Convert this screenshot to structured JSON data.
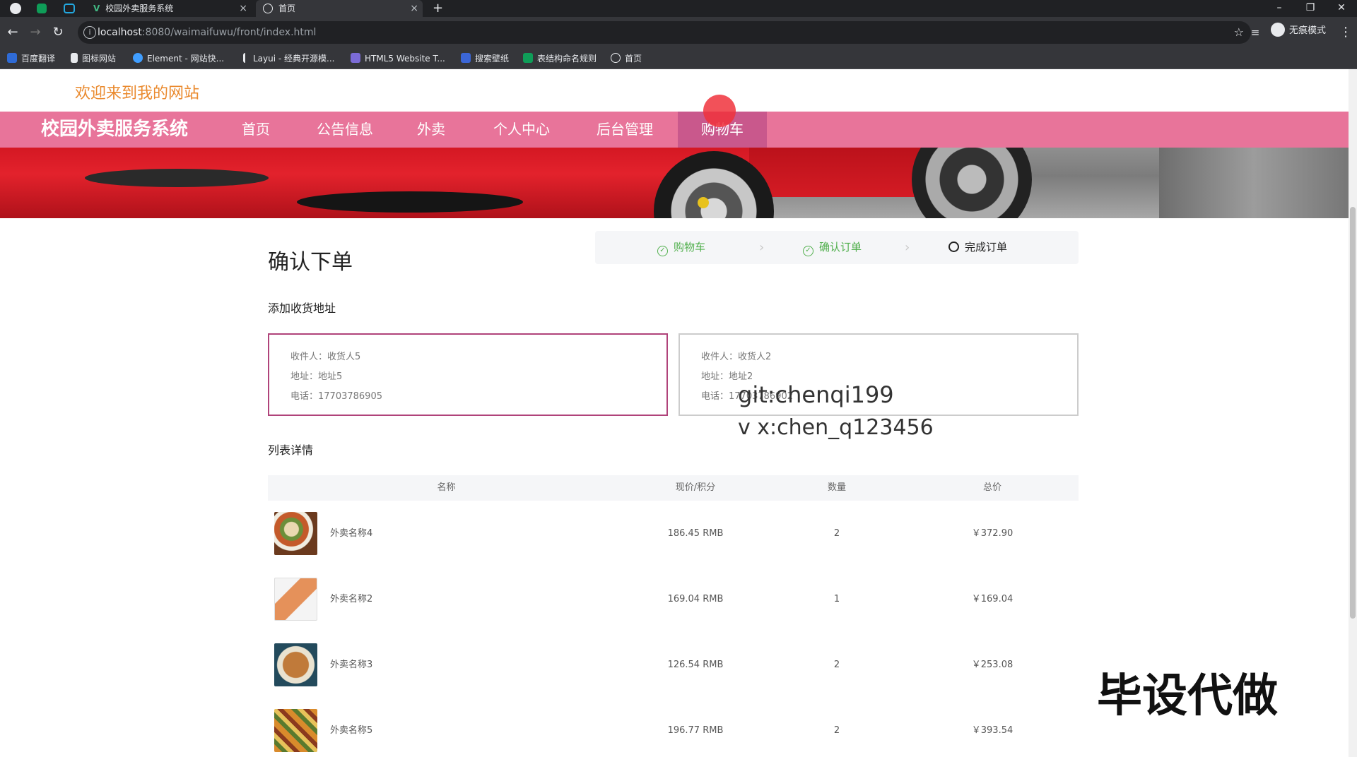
{
  "browser": {
    "tabs": [
      {
        "title": "校园外卖服务系统",
        "favicon": "vue-icon",
        "active": false
      },
      {
        "title": "首页",
        "favicon": "globe-icon",
        "active": true
      }
    ],
    "new_tab_label": "+",
    "url_host": "localhost",
    "url_rest": ":8080/waimaifuwu/front/index.html",
    "incognito_label": "无痕模式",
    "bookmarks": [
      "百度翻译",
      "图标网站",
      "Element - 网站快...",
      "Layui - 经典开源模...",
      "HTML5 Website T...",
      "搜索壁纸",
      "表结构命名规则",
      "首页"
    ]
  },
  "site": {
    "welcome": "欢迎来到我的网站",
    "brand": "校园外卖服务系统",
    "nav": [
      "首页",
      "公告信息",
      "外卖",
      "个人中心",
      "后台管理",
      "购物车"
    ],
    "active_nav": "购物车"
  },
  "checkout": {
    "title": "确认下单",
    "steps": [
      {
        "label": "购物车",
        "status": "done"
      },
      {
        "label": "确认订单",
        "status": "done"
      },
      {
        "label": "完成订单",
        "status": "pending"
      }
    ],
    "address_section": "添加收货地址",
    "addresses": [
      {
        "receiver": "收件人：收货人5",
        "address": "地址：地址5",
        "phone": "电话：17703786905",
        "selected": true
      },
      {
        "receiver": "收件人：收货人2",
        "address": "地址：地址2",
        "phone": "电话：17703786902",
        "selected": false
      }
    ],
    "list_section": "列表详情",
    "columns": [
      "名称",
      "现价/积分",
      "数量",
      "总价"
    ],
    "items": [
      {
        "name": "外卖名称4",
        "price": "186.45 RMB",
        "qty": "2",
        "total": "￥372.90"
      },
      {
        "name": "外卖名称2",
        "price": "169.04 RMB",
        "qty": "1",
        "total": "￥169.04"
      },
      {
        "name": "外卖名称3",
        "price": "126.54 RMB",
        "qty": "2",
        "total": "￥253.08"
      },
      {
        "name": "外卖名称5",
        "price": "196.77 RMB",
        "qty": "2",
        "total": "￥393.54"
      }
    ]
  },
  "overlays": {
    "line1": "git:chenqi199",
    "line2": "v x:chen_q123456",
    "line3": "毕设代做"
  }
}
